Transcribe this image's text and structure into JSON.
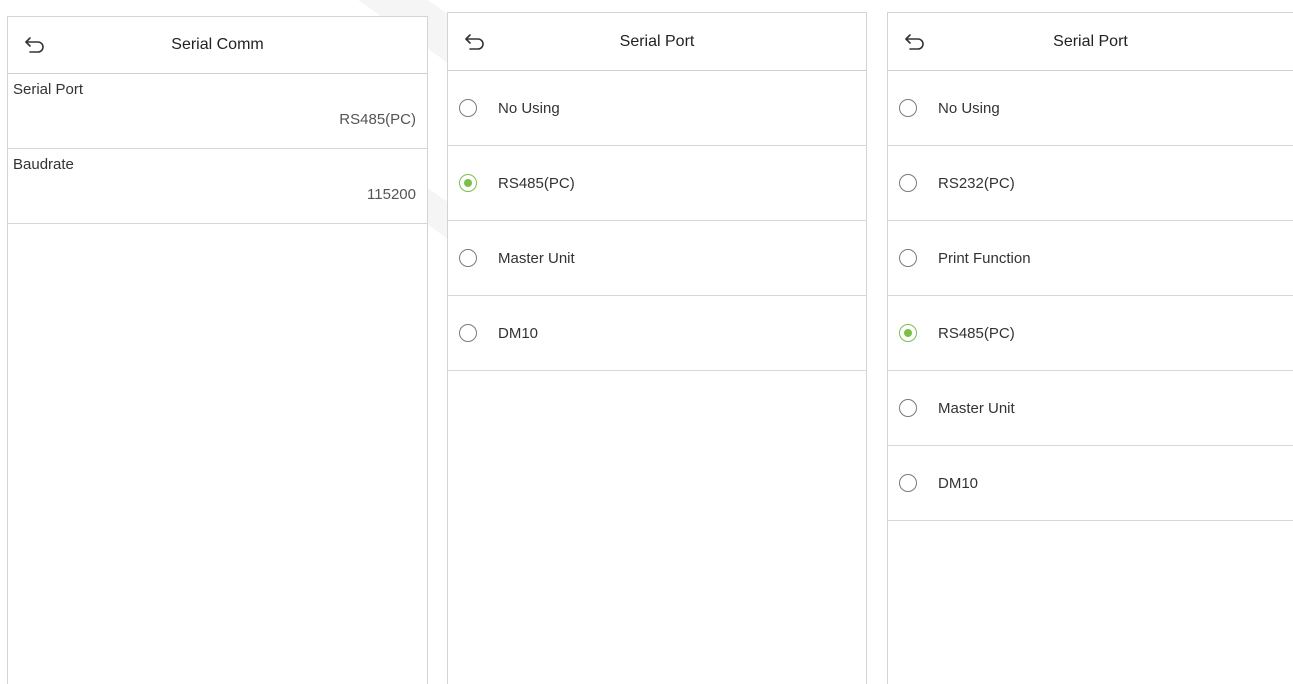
{
  "panels": [
    {
      "title": "Serial Comm",
      "back_icon": "undo-arrow-icon",
      "settings": [
        {
          "label": "Serial Port",
          "value": "RS485(PC)"
        },
        {
          "label": "Baudrate",
          "value": "115200"
        }
      ]
    },
    {
      "title": "Serial Port",
      "back_icon": "undo-arrow-icon",
      "options": [
        {
          "label": "No Using",
          "selected": false
        },
        {
          "label": "RS485(PC)",
          "selected": true
        },
        {
          "label": "Master Unit",
          "selected": false
        },
        {
          "label": "DM10",
          "selected": false
        }
      ]
    },
    {
      "title": "Serial Port",
      "back_icon": "undo-arrow-icon",
      "options": [
        {
          "label": "No Using",
          "selected": false
        },
        {
          "label": "RS232(PC)",
          "selected": false
        },
        {
          "label": "Print Function",
          "selected": false
        },
        {
          "label": "RS485(PC)",
          "selected": true
        },
        {
          "label": "Master Unit",
          "selected": false
        },
        {
          "label": "DM10",
          "selected": false
        }
      ]
    }
  ],
  "colors": {
    "selected_radio": "#7bbf49",
    "divider": "#d6d6d6",
    "text": "#333333"
  }
}
